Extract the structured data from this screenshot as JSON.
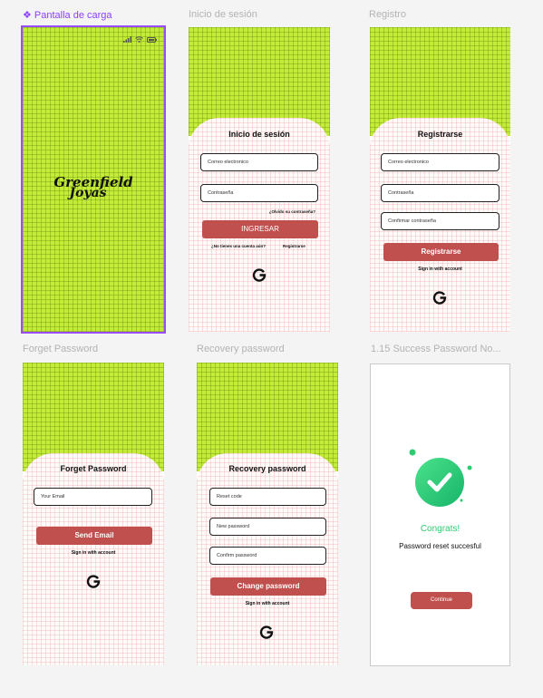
{
  "frames": {
    "splash": {
      "label": "❖ Pantalla de carga",
      "logo_line1": "Greenfield",
      "logo_line2": "Joyas"
    },
    "login": {
      "label": "Inicio de sesión",
      "title": "Inicio de sesión",
      "email_placeholder": "Correo electronico",
      "password_placeholder": "Contraseña",
      "forgot_link": "¿Olvido su contraseña?",
      "submit_label": "INGRESAR",
      "no_account_text": "¿No tienes una cuenta aún?",
      "register_link": "Registrarse"
    },
    "register": {
      "label": "Registro",
      "title": "Registrarse",
      "email_placeholder": "Correo electronico",
      "password_placeholder": "Contraseña",
      "confirm_placeholder": "Confirmar contraseña",
      "submit_label": "Registrarse",
      "google_text": "Sign in with account"
    },
    "forget": {
      "label": "Forget Password",
      "title": "Forget Password",
      "email_placeholder": "Your Email",
      "submit_label": "Send Email",
      "google_text": "Sign in with account"
    },
    "recovery": {
      "label": "Recovery password",
      "title": "Recovery password",
      "code_placeholder": "Reset code",
      "new_placeholder": "New password",
      "confirm_placeholder": "Confirm password",
      "submit_label": "Change password",
      "google_text": "Sign in with account"
    },
    "success": {
      "label": "1.15 Success Password No...",
      "heading": "Congrats!",
      "message": "Password reset succesful",
      "continue_label": "Continue"
    }
  },
  "icons": {
    "google": "google-g-icon",
    "check": "check-icon",
    "signal": "signal-icon",
    "wifi": "wifi-icon",
    "battery": "battery-icon"
  },
  "colors": {
    "green": "#c4eb37",
    "button": "#c0504d",
    "success": "#2ecc71",
    "selection": "#8b3fff"
  }
}
